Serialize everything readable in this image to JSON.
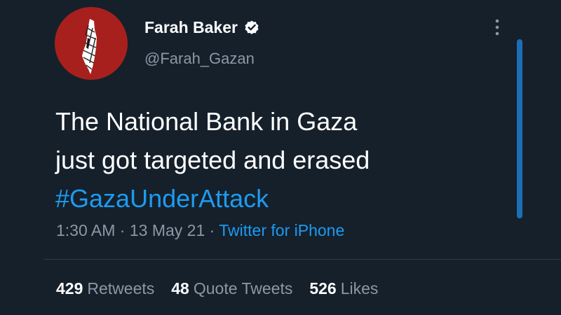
{
  "author": {
    "display_name": "Farah Baker",
    "handle": "@Farah_Gazan",
    "verified": true,
    "avatar_color": "#a8201d"
  },
  "tweet": {
    "text_lines": [
      "The National Bank in Gaza",
      "just got targeted and erased"
    ],
    "hashtag": "#GazaUnderAttack"
  },
  "meta": {
    "time": "1:30 AM",
    "separator": " · ",
    "date": "13 May 21",
    "source": "Twitter for iPhone"
  },
  "stats": {
    "retweets": {
      "count": "429",
      "label": "Retweets"
    },
    "quote_tweets": {
      "count": "48",
      "label": "Quote Tweets"
    },
    "likes": {
      "count": "526",
      "label": "Likes"
    }
  },
  "icons": {
    "verified": "verified-badge-icon",
    "more": "more-vertical-icon",
    "avatar_image": "palestine-map-icon"
  },
  "colors": {
    "background": "#15202b",
    "accent": "#1d9bf0",
    "muted": "#8b98a5",
    "scrollbar": "#1c6fb5"
  }
}
